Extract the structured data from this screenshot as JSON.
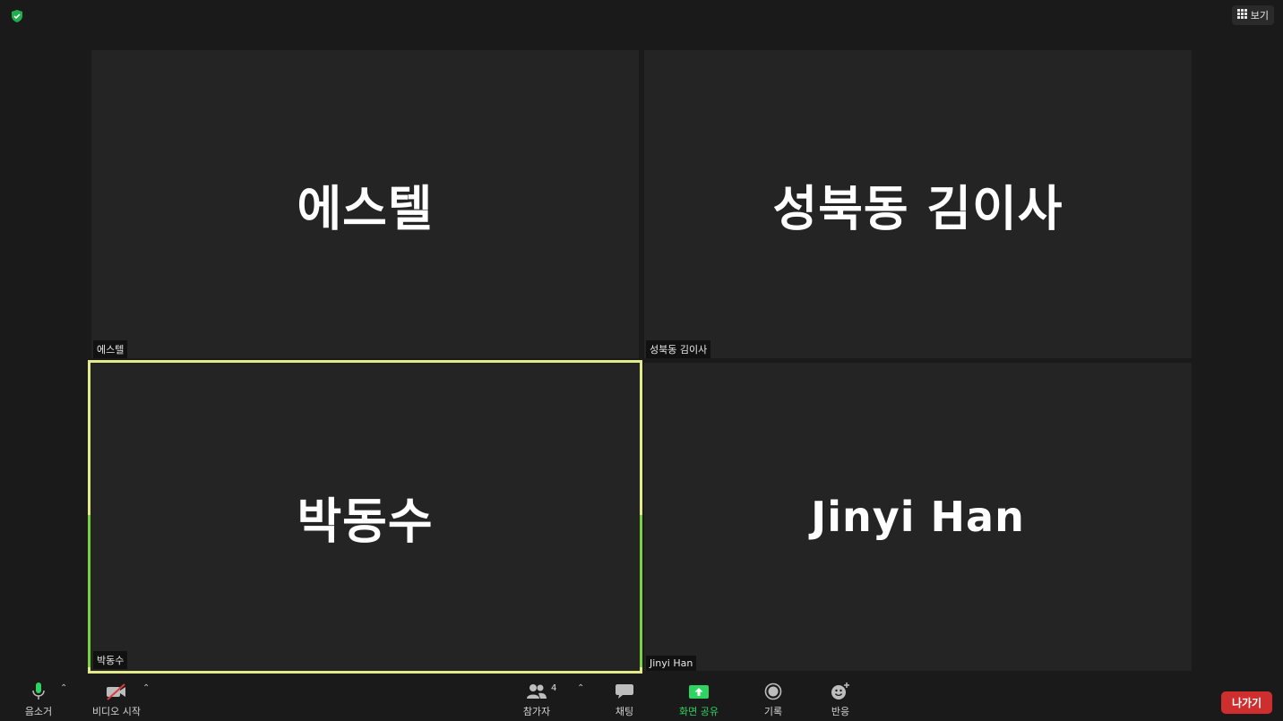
{
  "top": {
    "security_icon": "shield-check-icon",
    "view_label": "보기",
    "view_icon": "grid-icon"
  },
  "tiles": [
    {
      "display_name": "에스텔",
      "tag": "에스텔"
    },
    {
      "display_name": "성북동 김이사",
      "tag": "성북동 김이사"
    },
    {
      "display_name": "박동수",
      "tag": "박동수",
      "active_speaker": true
    },
    {
      "display_name": "Jinyi Han",
      "tag": "Jinyi Han"
    }
  ],
  "toolbar": {
    "mute_label": "음소거",
    "video_label": "비디오 시작",
    "participants_label": "참가자",
    "participants_count": "4",
    "chat_label": "채팅",
    "share_label": "화면 공유",
    "record_label": "기록",
    "reactions_label": "반응",
    "leave_label": "나가기"
  },
  "colors": {
    "active_border": "#e3ea8c",
    "speaking_green": "#7bd33a",
    "share_green": "#2fd361",
    "leave_red": "#cf2e2e"
  }
}
